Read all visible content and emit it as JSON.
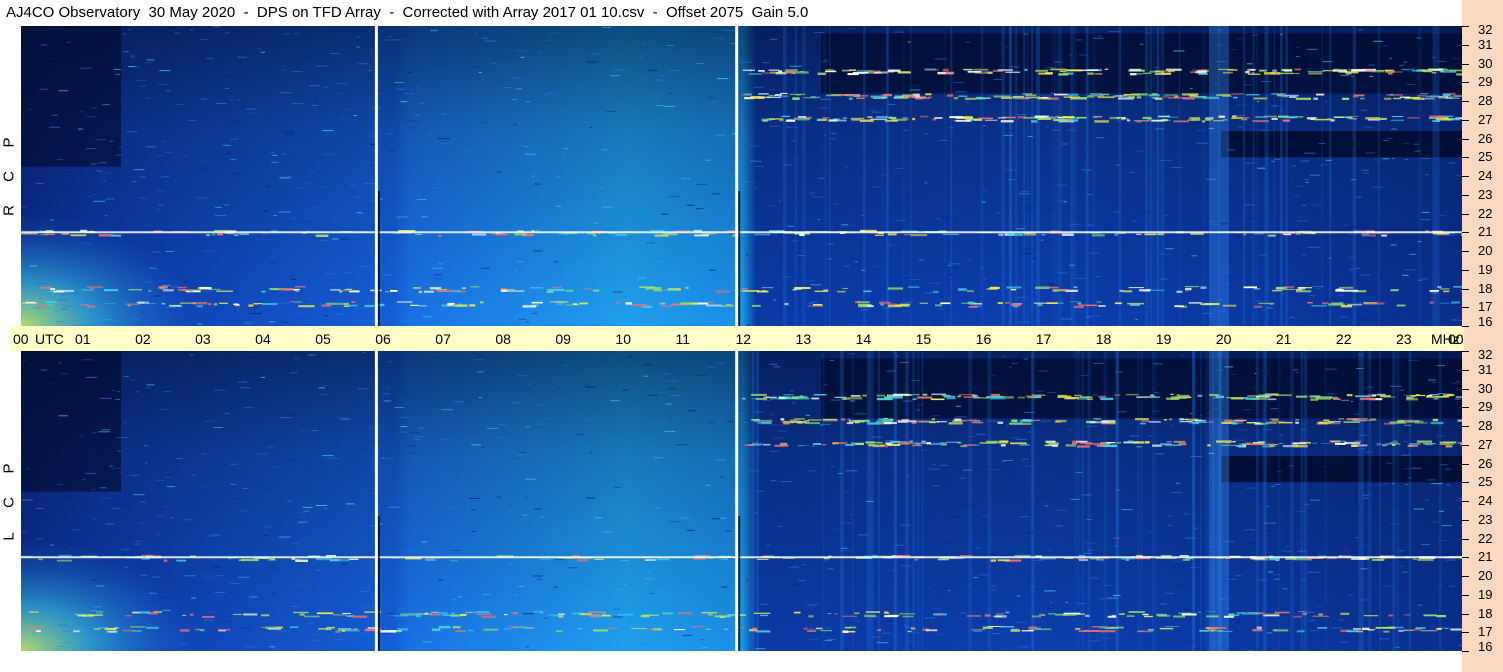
{
  "title": "AJ4CO Observatory  30 May 2020  -  DPS on TFD Array  -  Corrected with Array 2017 01 10.csv  -  Offset 2075  Gain 5.0",
  "chart_data": {
    "type": "heatmap",
    "title": "AJ4CO Observatory  30 May 2020  -  DPS on TFD Array  -  Corrected with Array 2017 01 10.csv  -  Offset 2075  Gain 5.0",
    "xlabel": "UTC",
    "ylabel": "MHz",
    "x_ticks": [
      "00",
      "01",
      "02",
      "03",
      "04",
      "05",
      "06",
      "07",
      "08",
      "09",
      "10",
      "11",
      "12",
      "13",
      "14",
      "15",
      "16",
      "17",
      "18",
      "19",
      "20",
      "21",
      "22",
      "23",
      "00"
    ],
    "x_range": [
      0,
      24
    ],
    "y_range": [
      16,
      32
    ],
    "y_ticks": [
      32,
      31,
      30,
      29,
      28,
      27,
      26,
      25,
      24,
      23,
      22,
      21,
      20,
      19,
      18,
      17,
      16
    ],
    "panels": [
      {
        "name": "R C P",
        "letters": [
          "R",
          "C",
          "P"
        ]
      },
      {
        "name": "L C P",
        "letters": [
          "L",
          "C",
          "P"
        ]
      }
    ],
    "markers_utc": [
      5.92,
      11.92
    ],
    "interference_bands_mhz": [
      27.1,
      21.0,
      18.0,
      17.2,
      28.3,
      29.6
    ],
    "colormap": [
      "#000a2a",
      "#0b2f99",
      "#1a5fd6",
      "#1aa8f0",
      "#3fd0e8",
      "#9be06a",
      "#f5e94a",
      "#f07070",
      "#ffffff"
    ]
  },
  "axis": {
    "utc_label": "UTC",
    "mhz_label": "MHz"
  }
}
